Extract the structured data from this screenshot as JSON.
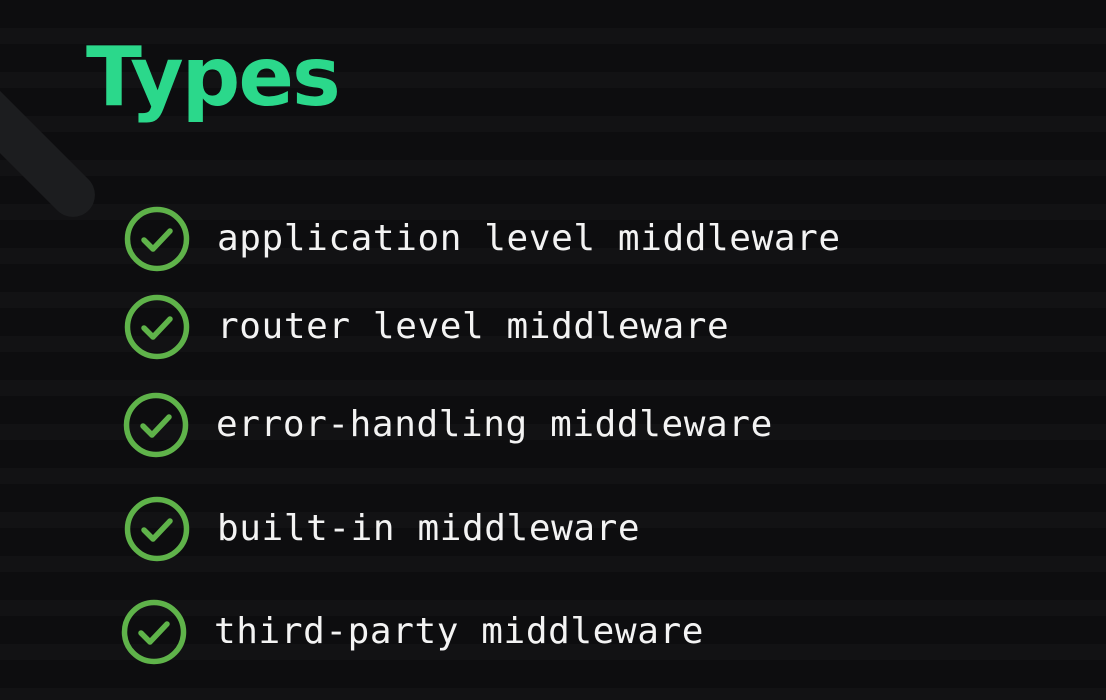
{
  "slide": {
    "title": "Types",
    "items": [
      {
        "label": "application level middleware",
        "icon": "check-circle-icon"
      },
      {
        "label": "router level middleware",
        "icon": "check-circle-icon"
      },
      {
        "label": "error-handling middleware",
        "icon": "check-circle-icon"
      },
      {
        "label": "built-in middleware",
        "icon": "check-circle-icon"
      },
      {
        "label": "third-party middleware",
        "icon": "check-circle-icon"
      }
    ]
  },
  "colors": {
    "background": "#0d0d0f",
    "title": "#2bd88b",
    "check": "#5fb34a",
    "text": "#f3f3f3"
  }
}
